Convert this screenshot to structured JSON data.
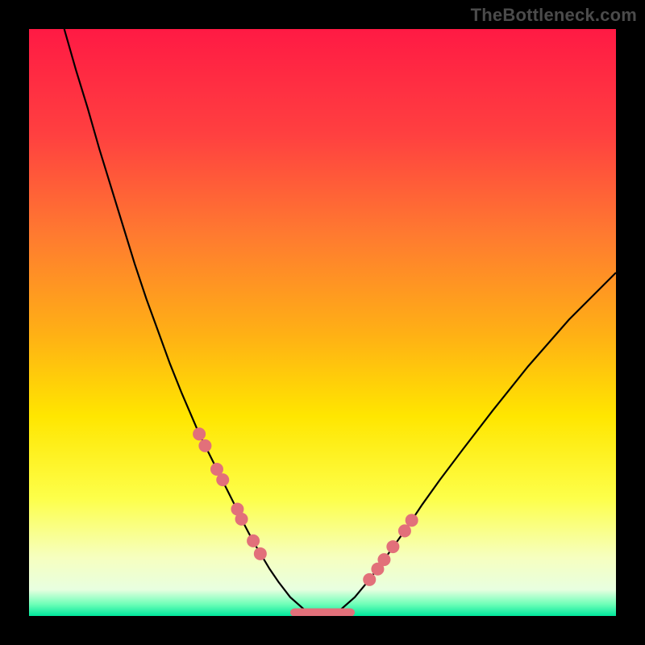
{
  "watermark": "TheBottleneck.com",
  "chart_data": {
    "type": "line",
    "title": "",
    "xlabel": "",
    "ylabel": "",
    "xlim": [
      0,
      1000
    ],
    "ylim": [
      0,
      1000
    ],
    "x": [
      60,
      80,
      100,
      120,
      140,
      160,
      180,
      200,
      220,
      240,
      260,
      275,
      290,
      305,
      320,
      335,
      350,
      362,
      374,
      386,
      398,
      410,
      425,
      445,
      470,
      500,
      530,
      555,
      575,
      595,
      615,
      640,
      670,
      700,
      740,
      790,
      850,
      920,
      1000
    ],
    "y": [
      1000,
      930,
      865,
      795,
      730,
      665,
      600,
      540,
      485,
      430,
      380,
      345,
      310,
      280,
      250,
      220,
      190,
      165,
      142,
      120,
      100,
      80,
      58,
      32,
      10,
      3,
      10,
      32,
      56,
      82,
      110,
      145,
      190,
      232,
      285,
      350,
      425,
      505,
      585
    ],
    "series": [
      {
        "name": "bottleneck-curve",
        "type": "line",
        "color": "#000000"
      },
      {
        "name": "tested-points-left",
        "type": "scatter",
        "color": "#e2707a",
        "x": [
          290,
          300,
          320,
          330,
          355,
          362,
          382,
          394
        ],
        "y": [
          310,
          290,
          250,
          232,
          182,
          165,
          128,
          106
        ]
      },
      {
        "name": "tested-points-right",
        "type": "scatter",
        "color": "#e2707a",
        "x": [
          580,
          594,
          605,
          620,
          640,
          652
        ],
        "y": [
          62,
          80,
          96,
          118,
          145,
          163
        ]
      },
      {
        "name": "min-plateau",
        "type": "bar-segment",
        "color": "#e2707a",
        "x0": 445,
        "x1": 555,
        "y": 6,
        "height": 14
      }
    ],
    "gradient_stops": [
      {
        "offset": 0.0,
        "color": "#ff1a44"
      },
      {
        "offset": 0.18,
        "color": "#ff4040"
      },
      {
        "offset": 0.35,
        "color": "#ff7a30"
      },
      {
        "offset": 0.52,
        "color": "#ffb015"
      },
      {
        "offset": 0.66,
        "color": "#ffe600"
      },
      {
        "offset": 0.8,
        "color": "#fdff4a"
      },
      {
        "offset": 0.9,
        "color": "#f6ffbf"
      },
      {
        "offset": 0.955,
        "color": "#e8ffe0"
      },
      {
        "offset": 0.98,
        "color": "#6effb8"
      },
      {
        "offset": 1.0,
        "color": "#00e79c"
      }
    ]
  }
}
